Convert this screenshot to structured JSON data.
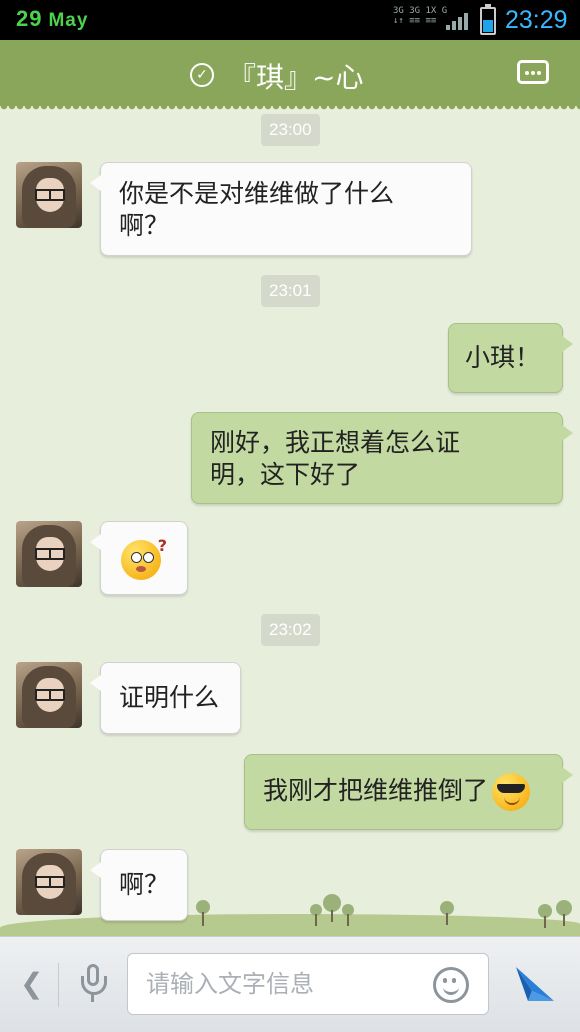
{
  "status_bar": {
    "date": "29",
    "month": "May",
    "network": [
      "3G 3G 1X G",
      "↓↑ ≡≡ ≡≡"
    ],
    "time": "23:29"
  },
  "header": {
    "title": "『琪』~心"
  },
  "messages": {
    "ts1": "23:00",
    "m1": [
      "你是不是对维维做了什么",
      "啊？"
    ],
    "ts2": "23:01",
    "m2": "小琪！",
    "m3": [
      "刚好，我正想着怎么证",
      "明，这下好了"
    ],
    "m4_emoji": "confused-face",
    "ts3": "23:02",
    "m5": "证明什么",
    "m6": "我刚才把维维推倒了",
    "m6_emoji": "cool-face",
    "m7": "啊？"
  },
  "composer": {
    "placeholder": "请输入文字信息"
  },
  "colors": {
    "header": "#8aa65a",
    "background": "#e7eedc",
    "outgoing_bubble": "#c3d9a2",
    "incoming_bubble": "#fbfbfb",
    "send": "#2a7fd8"
  }
}
